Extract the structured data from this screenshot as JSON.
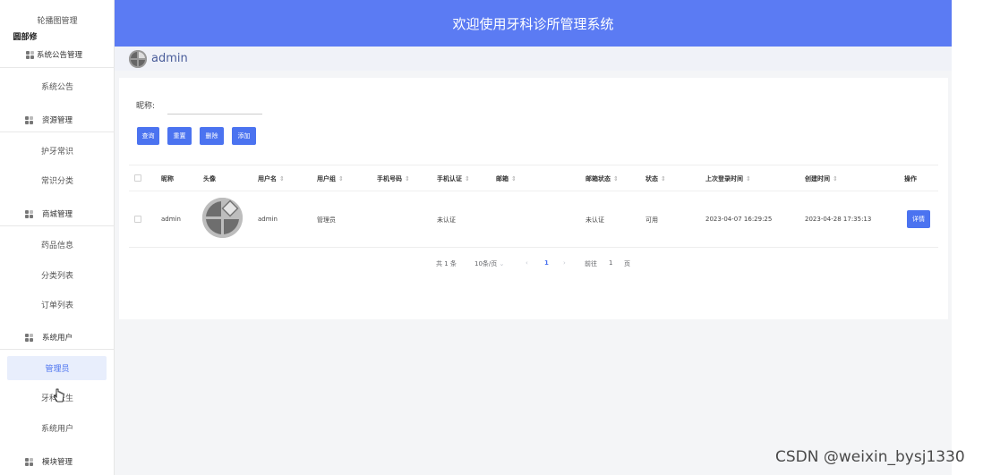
{
  "header": {
    "title": "欢迎使用牙科诊所管理系统"
  },
  "userbar": {
    "username": "admin"
  },
  "sidebar": {
    "top_item": "轮播图管理",
    "broken_text": "圆部修",
    "groups": [
      {
        "label": "系统公告管理",
        "items": [
          "系统公告"
        ]
      },
      {
        "label": "资源管理",
        "items": [
          "护牙常识",
          "常识分类"
        ]
      },
      {
        "label": "商城管理",
        "items": [
          "药品信息",
          "分类列表",
          "订单列表"
        ]
      },
      {
        "label": "系统用户",
        "items": [
          "管理员",
          "牙科医生",
          "系统用户"
        ]
      },
      {
        "label": "模块管理",
        "items": []
      }
    ],
    "active_item": "管理员"
  },
  "search": {
    "nick_label": "昵称:",
    "nick_value": "",
    "nick_placeholder": ""
  },
  "buttons": {
    "query": "查询",
    "reset": "重置",
    "delete": "删除",
    "add": "添加"
  },
  "table": {
    "columns": [
      "昵称",
      "头像",
      "用户名",
      "用户组",
      "手机号码",
      "手机认证",
      "邮箱",
      "邮箱状态",
      "状态",
      "上次登录时间",
      "创建时间",
      "操作"
    ],
    "rows": [
      {
        "nickname": "admin",
        "username": "admin",
        "group": "管理员",
        "phone": "",
        "phone_auth": "未认证",
        "email": "",
        "email_status": "未认证",
        "status": "可用",
        "last_login": "2023-04-07 16:29:25",
        "created": "2023-04-28 17:35:13",
        "action": "详情"
      }
    ]
  },
  "pagination": {
    "total": "共 1 条",
    "page_size": "10条/页",
    "current": "1",
    "goto_label": "前往",
    "goto_value": "1",
    "page_suffix": "页"
  },
  "watermark": "CSDN @weixin_bysj1330",
  "colors": {
    "primary": "#4b73f0",
    "header": "#5b7bf3"
  }
}
